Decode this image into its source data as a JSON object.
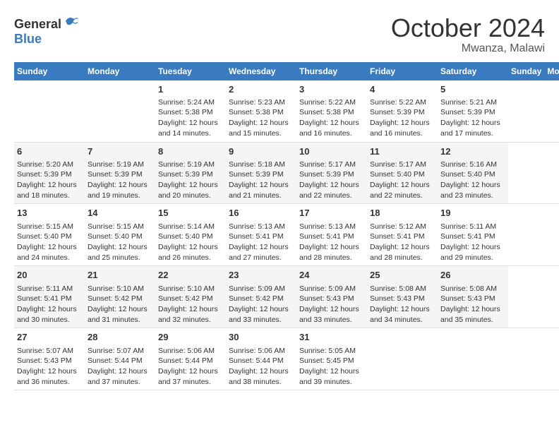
{
  "header": {
    "logo_general": "General",
    "logo_blue": "Blue",
    "month": "October 2024",
    "location": "Mwanza, Malawi"
  },
  "days_of_week": [
    "Sunday",
    "Monday",
    "Tuesday",
    "Wednesday",
    "Thursday",
    "Friday",
    "Saturday"
  ],
  "weeks": [
    [
      {
        "day": "",
        "sunrise": "",
        "sunset": "",
        "daylight": ""
      },
      {
        "day": "",
        "sunrise": "",
        "sunset": "",
        "daylight": ""
      },
      {
        "day": "1",
        "sunrise": "Sunrise: 5:24 AM",
        "sunset": "Sunset: 5:38 PM",
        "daylight": "Daylight: 12 hours and 14 minutes."
      },
      {
        "day": "2",
        "sunrise": "Sunrise: 5:23 AM",
        "sunset": "Sunset: 5:38 PM",
        "daylight": "Daylight: 12 hours and 15 minutes."
      },
      {
        "day": "3",
        "sunrise": "Sunrise: 5:22 AM",
        "sunset": "Sunset: 5:38 PM",
        "daylight": "Daylight: 12 hours and 16 minutes."
      },
      {
        "day": "4",
        "sunrise": "Sunrise: 5:22 AM",
        "sunset": "Sunset: 5:39 PM",
        "daylight": "Daylight: 12 hours and 16 minutes."
      },
      {
        "day": "5",
        "sunrise": "Sunrise: 5:21 AM",
        "sunset": "Sunset: 5:39 PM",
        "daylight": "Daylight: 12 hours and 17 minutes."
      }
    ],
    [
      {
        "day": "6",
        "sunrise": "Sunrise: 5:20 AM",
        "sunset": "Sunset: 5:39 PM",
        "daylight": "Daylight: 12 hours and 18 minutes."
      },
      {
        "day": "7",
        "sunrise": "Sunrise: 5:19 AM",
        "sunset": "Sunset: 5:39 PM",
        "daylight": "Daylight: 12 hours and 19 minutes."
      },
      {
        "day": "8",
        "sunrise": "Sunrise: 5:19 AM",
        "sunset": "Sunset: 5:39 PM",
        "daylight": "Daylight: 12 hours and 20 minutes."
      },
      {
        "day": "9",
        "sunrise": "Sunrise: 5:18 AM",
        "sunset": "Sunset: 5:39 PM",
        "daylight": "Daylight: 12 hours and 21 minutes."
      },
      {
        "day": "10",
        "sunrise": "Sunrise: 5:17 AM",
        "sunset": "Sunset: 5:39 PM",
        "daylight": "Daylight: 12 hours and 22 minutes."
      },
      {
        "day": "11",
        "sunrise": "Sunrise: 5:17 AM",
        "sunset": "Sunset: 5:40 PM",
        "daylight": "Daylight: 12 hours and 22 minutes."
      },
      {
        "day": "12",
        "sunrise": "Sunrise: 5:16 AM",
        "sunset": "Sunset: 5:40 PM",
        "daylight": "Daylight: 12 hours and 23 minutes."
      }
    ],
    [
      {
        "day": "13",
        "sunrise": "Sunrise: 5:15 AM",
        "sunset": "Sunset: 5:40 PM",
        "daylight": "Daylight: 12 hours and 24 minutes."
      },
      {
        "day": "14",
        "sunrise": "Sunrise: 5:15 AM",
        "sunset": "Sunset: 5:40 PM",
        "daylight": "Daylight: 12 hours and 25 minutes."
      },
      {
        "day": "15",
        "sunrise": "Sunrise: 5:14 AM",
        "sunset": "Sunset: 5:40 PM",
        "daylight": "Daylight: 12 hours and 26 minutes."
      },
      {
        "day": "16",
        "sunrise": "Sunrise: 5:13 AM",
        "sunset": "Sunset: 5:41 PM",
        "daylight": "Daylight: 12 hours and 27 minutes."
      },
      {
        "day": "17",
        "sunrise": "Sunrise: 5:13 AM",
        "sunset": "Sunset: 5:41 PM",
        "daylight": "Daylight: 12 hours and 28 minutes."
      },
      {
        "day": "18",
        "sunrise": "Sunrise: 5:12 AM",
        "sunset": "Sunset: 5:41 PM",
        "daylight": "Daylight: 12 hours and 28 minutes."
      },
      {
        "day": "19",
        "sunrise": "Sunrise: 5:11 AM",
        "sunset": "Sunset: 5:41 PM",
        "daylight": "Daylight: 12 hours and 29 minutes."
      }
    ],
    [
      {
        "day": "20",
        "sunrise": "Sunrise: 5:11 AM",
        "sunset": "Sunset: 5:41 PM",
        "daylight": "Daylight: 12 hours and 30 minutes."
      },
      {
        "day": "21",
        "sunrise": "Sunrise: 5:10 AM",
        "sunset": "Sunset: 5:42 PM",
        "daylight": "Daylight: 12 hours and 31 minutes."
      },
      {
        "day": "22",
        "sunrise": "Sunrise: 5:10 AM",
        "sunset": "Sunset: 5:42 PM",
        "daylight": "Daylight: 12 hours and 32 minutes."
      },
      {
        "day": "23",
        "sunrise": "Sunrise: 5:09 AM",
        "sunset": "Sunset: 5:42 PM",
        "daylight": "Daylight: 12 hours and 33 minutes."
      },
      {
        "day": "24",
        "sunrise": "Sunrise: 5:09 AM",
        "sunset": "Sunset: 5:43 PM",
        "daylight": "Daylight: 12 hours and 33 minutes."
      },
      {
        "day": "25",
        "sunrise": "Sunrise: 5:08 AM",
        "sunset": "Sunset: 5:43 PM",
        "daylight": "Daylight: 12 hours and 34 minutes."
      },
      {
        "day": "26",
        "sunrise": "Sunrise: 5:08 AM",
        "sunset": "Sunset: 5:43 PM",
        "daylight": "Daylight: 12 hours and 35 minutes."
      }
    ],
    [
      {
        "day": "27",
        "sunrise": "Sunrise: 5:07 AM",
        "sunset": "Sunset: 5:43 PM",
        "daylight": "Daylight: 12 hours and 36 minutes."
      },
      {
        "day": "28",
        "sunrise": "Sunrise: 5:07 AM",
        "sunset": "Sunset: 5:44 PM",
        "daylight": "Daylight: 12 hours and 37 minutes."
      },
      {
        "day": "29",
        "sunrise": "Sunrise: 5:06 AM",
        "sunset": "Sunset: 5:44 PM",
        "daylight": "Daylight: 12 hours and 37 minutes."
      },
      {
        "day": "30",
        "sunrise": "Sunrise: 5:06 AM",
        "sunset": "Sunset: 5:44 PM",
        "daylight": "Daylight: 12 hours and 38 minutes."
      },
      {
        "day": "31",
        "sunrise": "Sunrise: 5:05 AM",
        "sunset": "Sunset: 5:45 PM",
        "daylight": "Daylight: 12 hours and 39 minutes."
      },
      {
        "day": "",
        "sunrise": "",
        "sunset": "",
        "daylight": ""
      },
      {
        "day": "",
        "sunrise": "",
        "sunset": "",
        "daylight": ""
      }
    ]
  ]
}
